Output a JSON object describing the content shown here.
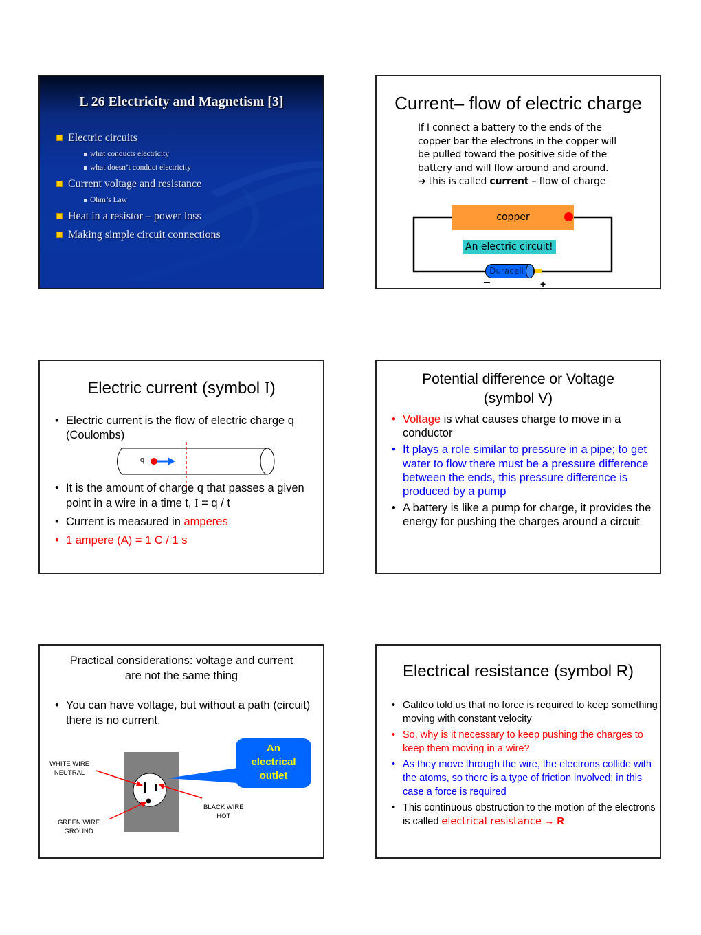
{
  "slides": [
    {
      "title": "L 26 Electricity and Magnetism [3]",
      "items": [
        {
          "level": 1,
          "text": "Electric circuits"
        },
        {
          "level": 2,
          "text": "what conducts electricity"
        },
        {
          "level": 2,
          "text": "what doesn’t conduct electricity"
        },
        {
          "level": 1,
          "text": "Current voltage and resistance"
        },
        {
          "level": 2,
          "text": "Ohm’s Law"
        },
        {
          "level": 1,
          "text": "Heat in a resistor – power loss"
        },
        {
          "level": 1,
          "text": "Making simple circuit connections"
        }
      ]
    },
    {
      "title": "Current– flow of electric charge",
      "body_lines": [
        "If I connect a battery to the ends of the",
        "copper bar the electrons in the copper will",
        "be pulled toward the positive side of the",
        "battery and will flow around and around."
      ],
      "arrow_glyph": "➔",
      "conclusion_pre": " this is called ",
      "conclusion_bold": "current",
      "conclusion_post": " – flow of charge",
      "diagram": {
        "copper_label": "copper",
        "circuit_label": "An electric circuit!",
        "battery_label": "Duracell",
        "minus": "−",
        "plus": "+",
        "colors": {
          "copper": "#ff9933",
          "label_bg": "#33cccc",
          "battery": "#0066ff",
          "dot": "#ff0000"
        }
      }
    },
    {
      "title_pre": "Electric current (symbol ",
      "title_symbol": "I",
      "title_post": ")",
      "bullet1": "Electric current is the flow of electric charge q (Coulombs)",
      "charge_label": "q",
      "bullet2_pre": "It is the amount of charge q that passes a given point in a wire in a time t, ",
      "bullet2_formula_sym": "I",
      "bullet2_formula_rest": " = q / t",
      "bullet3_pre": "Current is measured in ",
      "bullet3_red": "amperes",
      "bullet4": "1 ampere (A) = 1 C / 1 s"
    },
    {
      "title_line1": "Potential difference or Voltage",
      "title_line2": "(symbol V)",
      "bullet1_red": "Voltage",
      "bullet1_rest": " is what causes charge to move in a conductor",
      "bullet2": "It plays a role similar to pressure in a pipe; to get water to flow there must be a pressure difference between the ends, this pressure difference is produced by a pump",
      "bullet3": "A battery is like a pump for charge, it provides the energy for pushing the charges around a circuit"
    },
    {
      "title_line1": "Practical considerations: voltage and current",
      "title_line2": "are not the same thing",
      "bullet1": "You can have voltage, but without a path (circuit) there is no current.",
      "diagram": {
        "white_wire": [
          "WHITE WIRE",
          "NEUTRAL"
        ],
        "black_wire": [
          "BLACK WIRE",
          "HOT"
        ],
        "green_wire": [
          "GREEN WIRE",
          "GROUND"
        ],
        "callout": [
          "An",
          "electrical",
          "outlet"
        ]
      }
    },
    {
      "title": "Electrical resistance (symbol R)",
      "bullet1": "Galileo told us that no force is required to keep something moving with constant velocity",
      "bullet2": "So, why is it necessary to keep pushing the charges to keep them moving in a wire?",
      "bullet3": "As they move through the wire, the electrons collide with the atoms, so there is a type of friction involved; in this case a force is required",
      "bullet4_pre": "This continuous obstruction to the motion of the electrons is called ",
      "bullet4_red": "electrical resistance",
      "bullet4_arrow": " → ",
      "bullet4_bold": "R"
    }
  ]
}
